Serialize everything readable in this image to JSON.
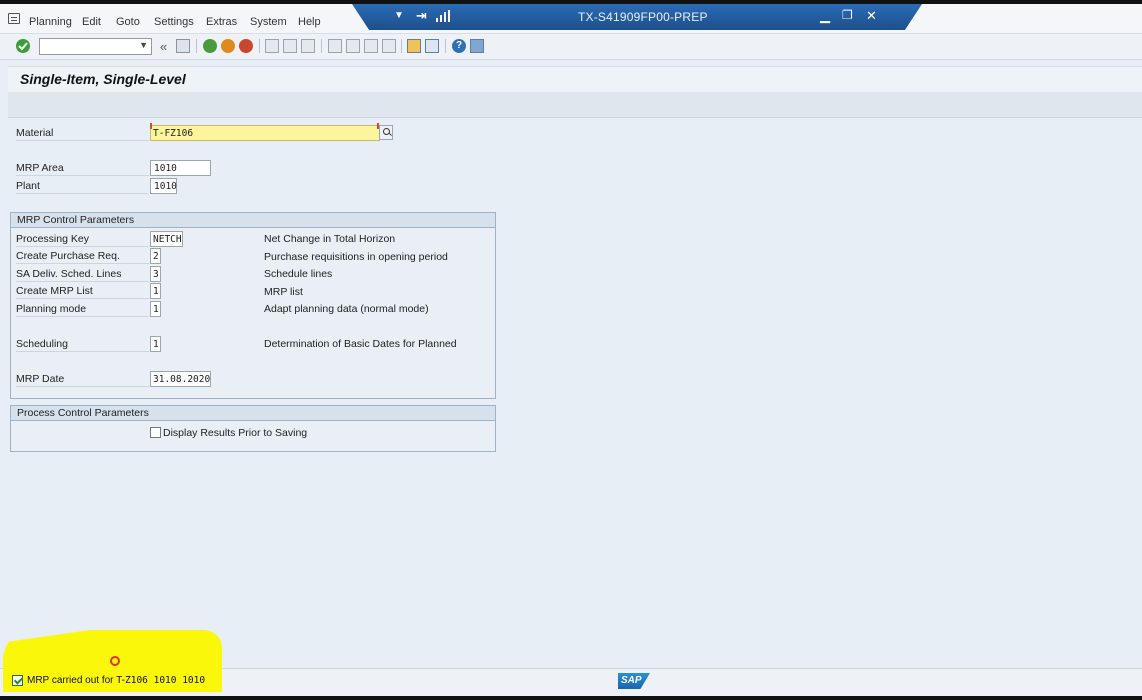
{
  "window": {
    "title": "TX-S41909FP00-PREP"
  },
  "menu": {
    "items": [
      "Planning",
      "Edit",
      "Goto",
      "Settings",
      "Extras",
      "System",
      "Help"
    ]
  },
  "toolbar": {
    "command_value": ""
  },
  "page": {
    "title": "Single-Item, Single-Level"
  },
  "form": {
    "material": {
      "label": "Material",
      "value": "T-FZ106"
    },
    "mrp_area": {
      "label": "MRP Area",
      "value": "1010"
    },
    "plant": {
      "label": "Plant",
      "value": "1010"
    }
  },
  "mrp_control": {
    "heading": "MRP Control Parameters",
    "rows": [
      {
        "label": "Processing Key",
        "value": "NETCH",
        "desc": "Net Change in Total Horizon"
      },
      {
        "label": "Create Purchase Req.",
        "value": "2",
        "desc": "Purchase requisitions in opening period"
      },
      {
        "label": "SA Deliv. Sched. Lines",
        "value": "3",
        "desc": "Schedule lines"
      },
      {
        "label": "Create MRP List",
        "value": "1",
        "desc": "MRP list"
      },
      {
        "label": "Planning mode",
        "value": "1",
        "desc": "Adapt planning data (normal mode)"
      },
      {
        "label": "Scheduling",
        "value": "1",
        "desc": "Determination of Basic Dates for Planned"
      },
      {
        "label": "MRP Date",
        "value": "31.08.2020",
        "desc": ""
      }
    ]
  },
  "process_control": {
    "heading": "Process Control Parameters",
    "display_results_label": "Display Results Prior to Saving",
    "display_results_checked": false
  },
  "status": {
    "message_prefix": "MRP carried out for T-",
    "message_rest": "Z106  1010  1010",
    "logo": "SAP"
  },
  "colors": {
    "title_bar": "#1d4f8c",
    "required_field": "#fdf59b",
    "highlight": "#fbf70b"
  }
}
